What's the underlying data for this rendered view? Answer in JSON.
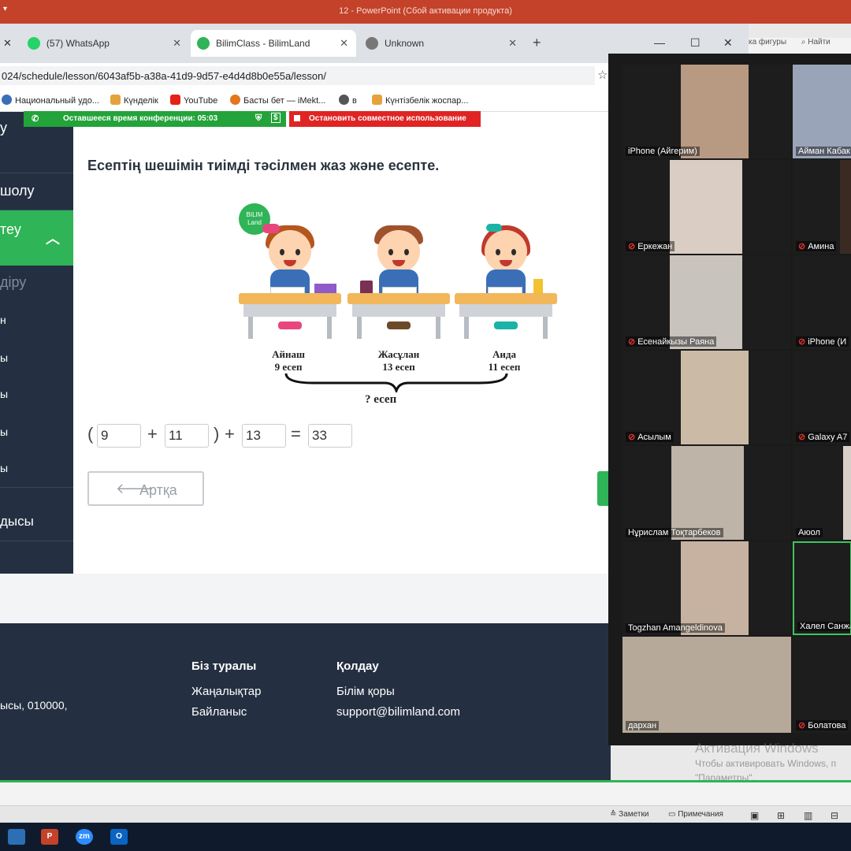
{
  "powerpoint": {
    "window_title": "12 - PowerPoint (Сбой активации продукта)",
    "ribbon_snippet": "ка фигуры",
    "ribbon_find": "Найти",
    "status_notes": "Заметки",
    "status_comments": "Примечания"
  },
  "browser": {
    "tabs": [
      {
        "label": "(57) WhatsApp",
        "color": "#25d366"
      },
      {
        "label": "BilimClass - BilimLand",
        "color": "#2fb457"
      },
      {
        "label": "Unknown",
        "color": "#777777"
      }
    ],
    "url": "024/schedule/lesson/6043af5b-a38a-41d9-9d57-e4d4d8b0e55a/lesson/",
    "bookmarks": [
      "Национальный удо...",
      "Күнделік",
      "YouTube",
      "Басты бет — iMekt...",
      "в",
      "Күнтізбелік жоспар..."
    ]
  },
  "conference": {
    "time_left": "Оставшееся время конференции: 05:03",
    "stop_share": "Остановить совместное использование"
  },
  "sidebar": {
    "items": [
      "у",
      "шолу",
      "теу",
      "діру",
      "н",
      "ы",
      "ы",
      "ы",
      "ы",
      "дысы"
    ]
  },
  "lesson": {
    "title": "Есептің шешімін тиімді тәсілмен жаз және есепте.",
    "logo_line1": "BILIM",
    "logo_line2": "Land",
    "students": [
      {
        "name": "Айнаш",
        "tasks": "9 есеп"
      },
      {
        "name": "Жасұлан",
        "tasks": "13 есеп"
      },
      {
        "name": "Аида",
        "tasks": "11 есеп"
      }
    ],
    "question": "? есеп",
    "equation": {
      "a": "9",
      "b": "11",
      "c": "13",
      "result": "33"
    },
    "back_label": "Артқа"
  },
  "footer": {
    "address": "ысы, 010000,",
    "col1_title": "Біз туралы",
    "col1_links": [
      "Жаңалықтар",
      "Байланыс"
    ],
    "col2_title": "Қолдау",
    "col2_links": [
      "Білім қоры",
      "support@bilimland.com"
    ]
  },
  "zoom": {
    "participants_left": [
      "iPhone (Айгерим)",
      "Еркежан",
      "Есенайкызы Раяна",
      "Асылым",
      "Нұрислам Тоқтарбеков",
      "Togzhan Amangeldinova",
      "дархан"
    ],
    "participants_right": [
      "Айман Кабак",
      "Амина",
      "iPhone (И",
      "Galaxy A7",
      "Аюол",
      "Халел Санжа",
      "Болатова"
    ]
  },
  "watermark": {
    "line1": "Активация Windows",
    "line2": "Чтобы активировать Windows, п",
    "line3": "\"Параметры\"."
  },
  "taskbar": [
    "Explorer",
    "P",
    "zm",
    "O"
  ]
}
